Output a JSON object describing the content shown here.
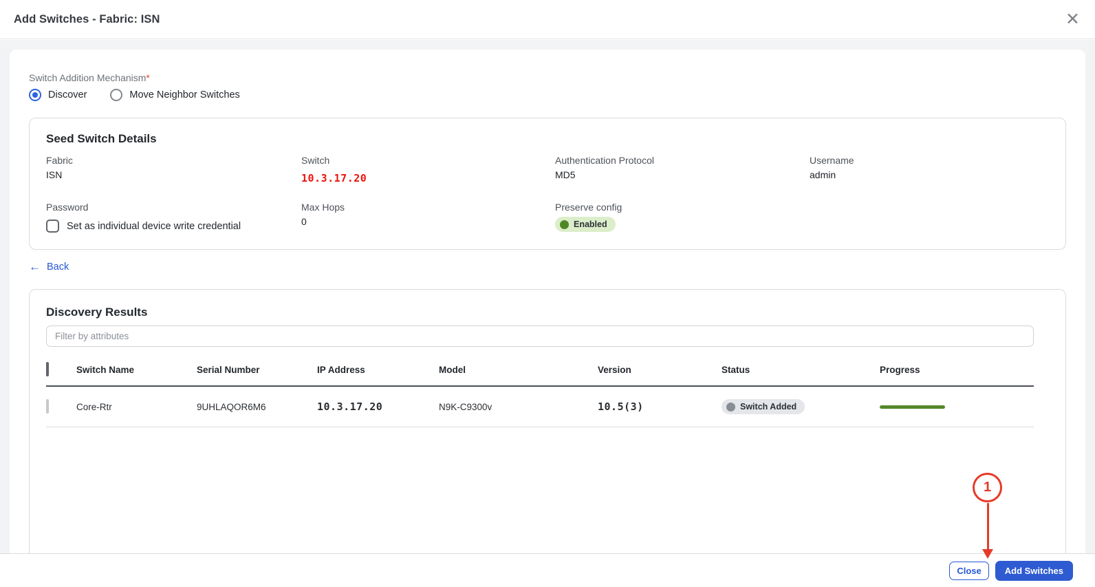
{
  "header": {
    "title": "Add Switches - Fabric: ISN",
    "close_icon": "✕"
  },
  "mechanism": {
    "label": "Switch Addition Mechanism",
    "required_mark": "*",
    "options": [
      {
        "label": "Discover",
        "selected": true
      },
      {
        "label": "Move Neighbor Switches",
        "selected": false
      }
    ]
  },
  "seed_details": {
    "title": "Seed Switch Details",
    "fabric_label": "Fabric",
    "fabric_value": "ISN",
    "switch_label": "Switch",
    "switch_value": "10.3.17.20",
    "auth_label": "Authentication Protocol",
    "auth_value": "MD5",
    "username_label": "Username",
    "username_value": "admin",
    "password_label": "Password",
    "max_hops_label": "Max Hops",
    "max_hops_value": "0",
    "preserve_label": "Preserve config",
    "preserve_value": "Enabled",
    "checkbox_label": "Set as individual device write credential"
  },
  "back_link": {
    "label": "Back",
    "icon": "←"
  },
  "discovery": {
    "title": "Discovery Results",
    "filter_placeholder": "Filter by attributes",
    "columns": [
      "Switch Name",
      "Serial Number",
      "IP Address",
      "Model",
      "Version",
      "Status",
      "Progress"
    ],
    "rows": [
      {
        "switch_name": "Core-Rtr",
        "serial_number": "9UHLAQOR6M6",
        "ip_address": "10.3.17.20",
        "model": "N9K-C9300v",
        "version": "10.5(3)",
        "status": "Switch Added",
        "progress_percent": 100
      }
    ]
  },
  "footer": {
    "close_label": "Close",
    "add_label": "Add Switches"
  },
  "annotation": {
    "step_number": "1"
  },
  "colors": {
    "accent_blue": "#2e5bd2",
    "annotation_red": "#e63a28",
    "highlight_red_text": "#ec130c",
    "success_green_dot": "#4f8726",
    "success_green_bg": "#dcedca",
    "neutral_badge_bg": "#e4e6e9",
    "progress_green": "#55872c"
  }
}
